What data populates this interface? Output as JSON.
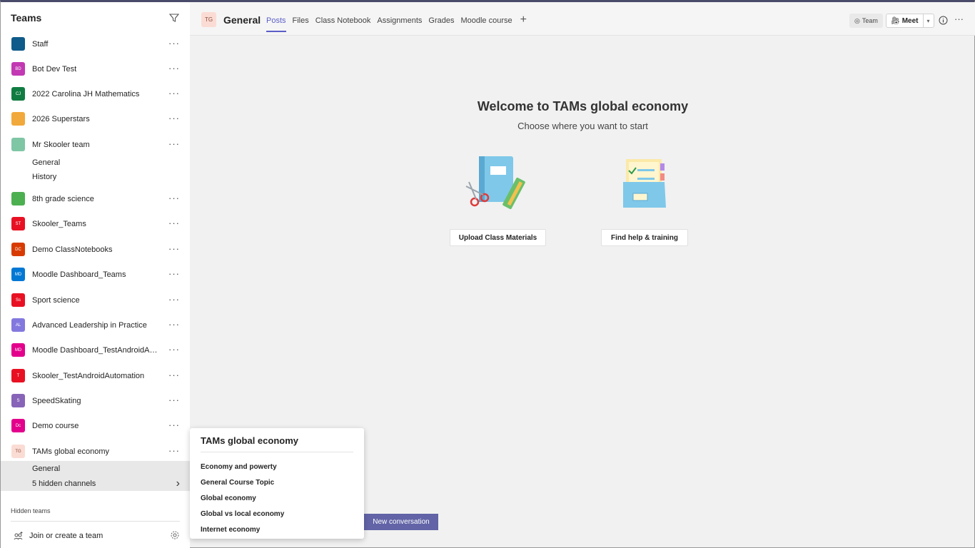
{
  "sidebar": {
    "title": "Teams",
    "teams": [
      {
        "name": "Staff",
        "initials": "",
        "color": "#0f5b8a"
      },
      {
        "name": "Bot Dev Test",
        "initials": "BD",
        "color": "#c239b3"
      },
      {
        "name": "2022 Carolina JH Mathematics",
        "initials": "CJ",
        "color": "#107c41"
      },
      {
        "name": "2026 Superstars",
        "initials": "",
        "color": "#f2a93b"
      },
      {
        "name": "Mr Skooler team",
        "initials": "",
        "color": "#7fc6a4"
      },
      {
        "name": "8th grade science",
        "initials": "",
        "color": "#4caf50"
      },
      {
        "name": "Skooler_Teams",
        "initials": "ST",
        "color": "#e81123"
      },
      {
        "name": "Demo ClassNotebooks",
        "initials": "DC",
        "color": "#d83b01"
      },
      {
        "name": "Moodle Dashboard_Teams",
        "initials": "MD",
        "color": "#0078d4"
      },
      {
        "name": "Sport science",
        "initials": "Ss",
        "color": "#e81123"
      },
      {
        "name": "Advanced Leadership in Practice",
        "initials": "AL",
        "color": "#8378de"
      },
      {
        "name": "Moodle Dashboard_TestAndroidAuto...",
        "initials": "MD",
        "color": "#e3008c"
      },
      {
        "name": "Skooler_TestAndroidAutomation",
        "initials": "T",
        "color": "#e81123"
      },
      {
        "name": "SpeedSkating",
        "initials": "S",
        "color": "#8764b8"
      },
      {
        "name": "Demo course",
        "initials": "Dc",
        "color": "#e3008c"
      },
      {
        "name": "TAMs global economy",
        "initials": "TG",
        "color": "#fbdcd4"
      }
    ],
    "mr_skooler_channels": [
      "General",
      "History"
    ],
    "tams_channels": [
      "General",
      "5 hidden channels"
    ],
    "hidden_teams": "Hidden teams",
    "join": "Join or create a team"
  },
  "header": {
    "badge": "TG",
    "channel": "General",
    "tabs": [
      "Posts",
      "Files",
      "Class Notebook",
      "Assignments",
      "Grades",
      "Moodle course"
    ],
    "team_btn": "Team",
    "meet_btn": "Meet"
  },
  "main": {
    "title": "Welcome to TAMs global economy",
    "subtitle": "Choose where you want to start",
    "upload_btn": "Upload Class Materials",
    "help_btn": "Find help & training",
    "new_conversation": "New conversation"
  },
  "popup": {
    "title": "TAMs global economy",
    "items": [
      "Economy and powerty",
      "General Course Topic",
      "Global economy",
      "Global vs local economy",
      "Internet economy"
    ]
  }
}
